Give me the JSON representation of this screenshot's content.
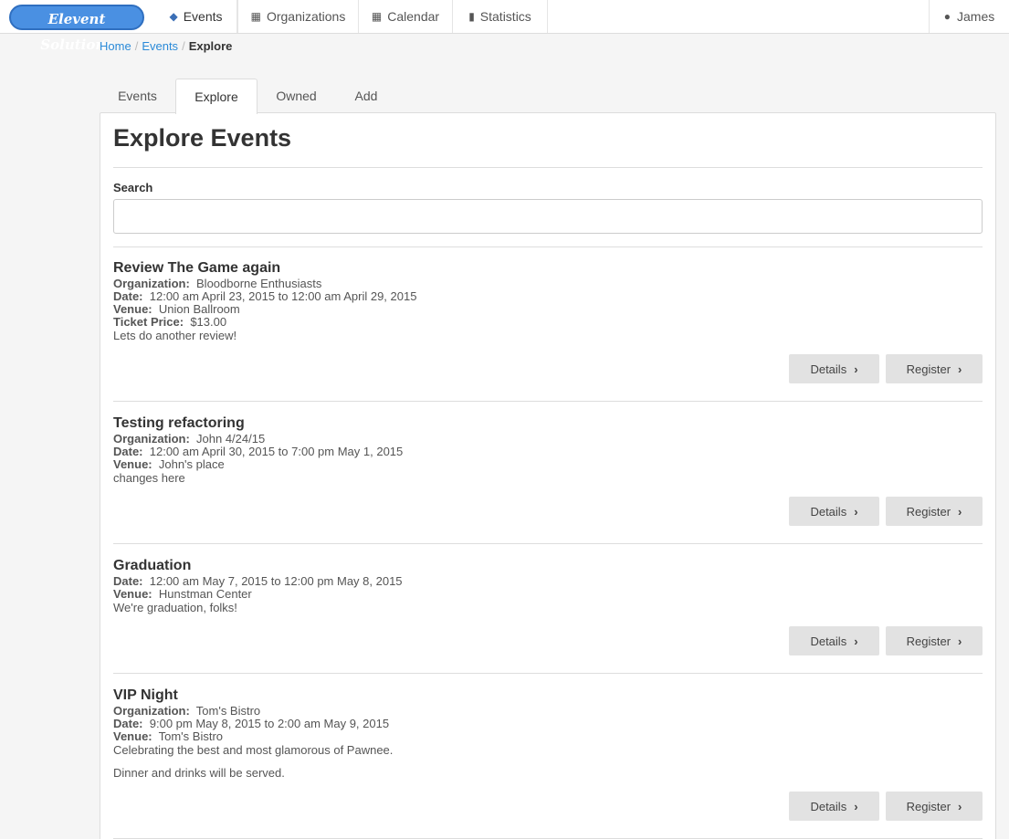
{
  "brand": {
    "name": "Elevent Solutions"
  },
  "nav": {
    "items": [
      {
        "label": "Events",
        "icon": "ticket-icon"
      },
      {
        "label": "Organizations",
        "icon": "building-icon"
      },
      {
        "label": "Calendar",
        "icon": "calendar-icon"
      },
      {
        "label": "Statistics",
        "icon": "bar-chart-icon"
      }
    ],
    "active_index": 0,
    "user": {
      "label": "James",
      "icon": "user-icon"
    }
  },
  "breadcrumb": {
    "home": "Home",
    "events": "Events",
    "current": "Explore",
    "separator": "/"
  },
  "tabs": {
    "items": [
      "Events",
      "Explore",
      "Owned",
      "Add"
    ],
    "active_index": 1
  },
  "page": {
    "title": "Explore Events",
    "search_label": "Search",
    "search_value": ""
  },
  "labels": {
    "organization": "Organization:",
    "date": "Date:",
    "venue": "Venue:",
    "ticket_price": "Ticket Price:",
    "details_button": "Details",
    "register_button": "Register"
  },
  "events": [
    {
      "title": "Review The Game again",
      "organization": "Bloodborne Enthusiasts",
      "date": "12:00 am April 23, 2015 to 12:00 am April 29, 2015",
      "venue": "Union Ballroom",
      "ticket_price": "$13.00",
      "description": [
        "Lets do another review!"
      ]
    },
    {
      "title": "Testing refactoring",
      "organization": "John 4/24/15",
      "date": "12:00 am April 30, 2015 to 7:00 pm May 1, 2015",
      "venue": "John's place",
      "description": [
        "changes here"
      ]
    },
    {
      "title": "Graduation",
      "date": "12:00 am May 7, 2015 to 12:00 pm May 8, 2015",
      "venue": "Hunstman Center",
      "description": [
        "We're graduation, folks!"
      ]
    },
    {
      "title": "VIP Night",
      "organization": "Tom's Bistro",
      "date": "9:00 pm May 8, 2015 to 2:00 am May 9, 2015",
      "venue": "Tom's Bistro",
      "description": [
        "Celebrating the best and most glamorous of Pawnee.",
        "Dinner and drinks will be served."
      ]
    }
  ],
  "colors": {
    "link": "#2a8ad8",
    "brand": "#4a90e2",
    "button_bg": "#e2e2e2",
    "border": "#dddddd"
  }
}
